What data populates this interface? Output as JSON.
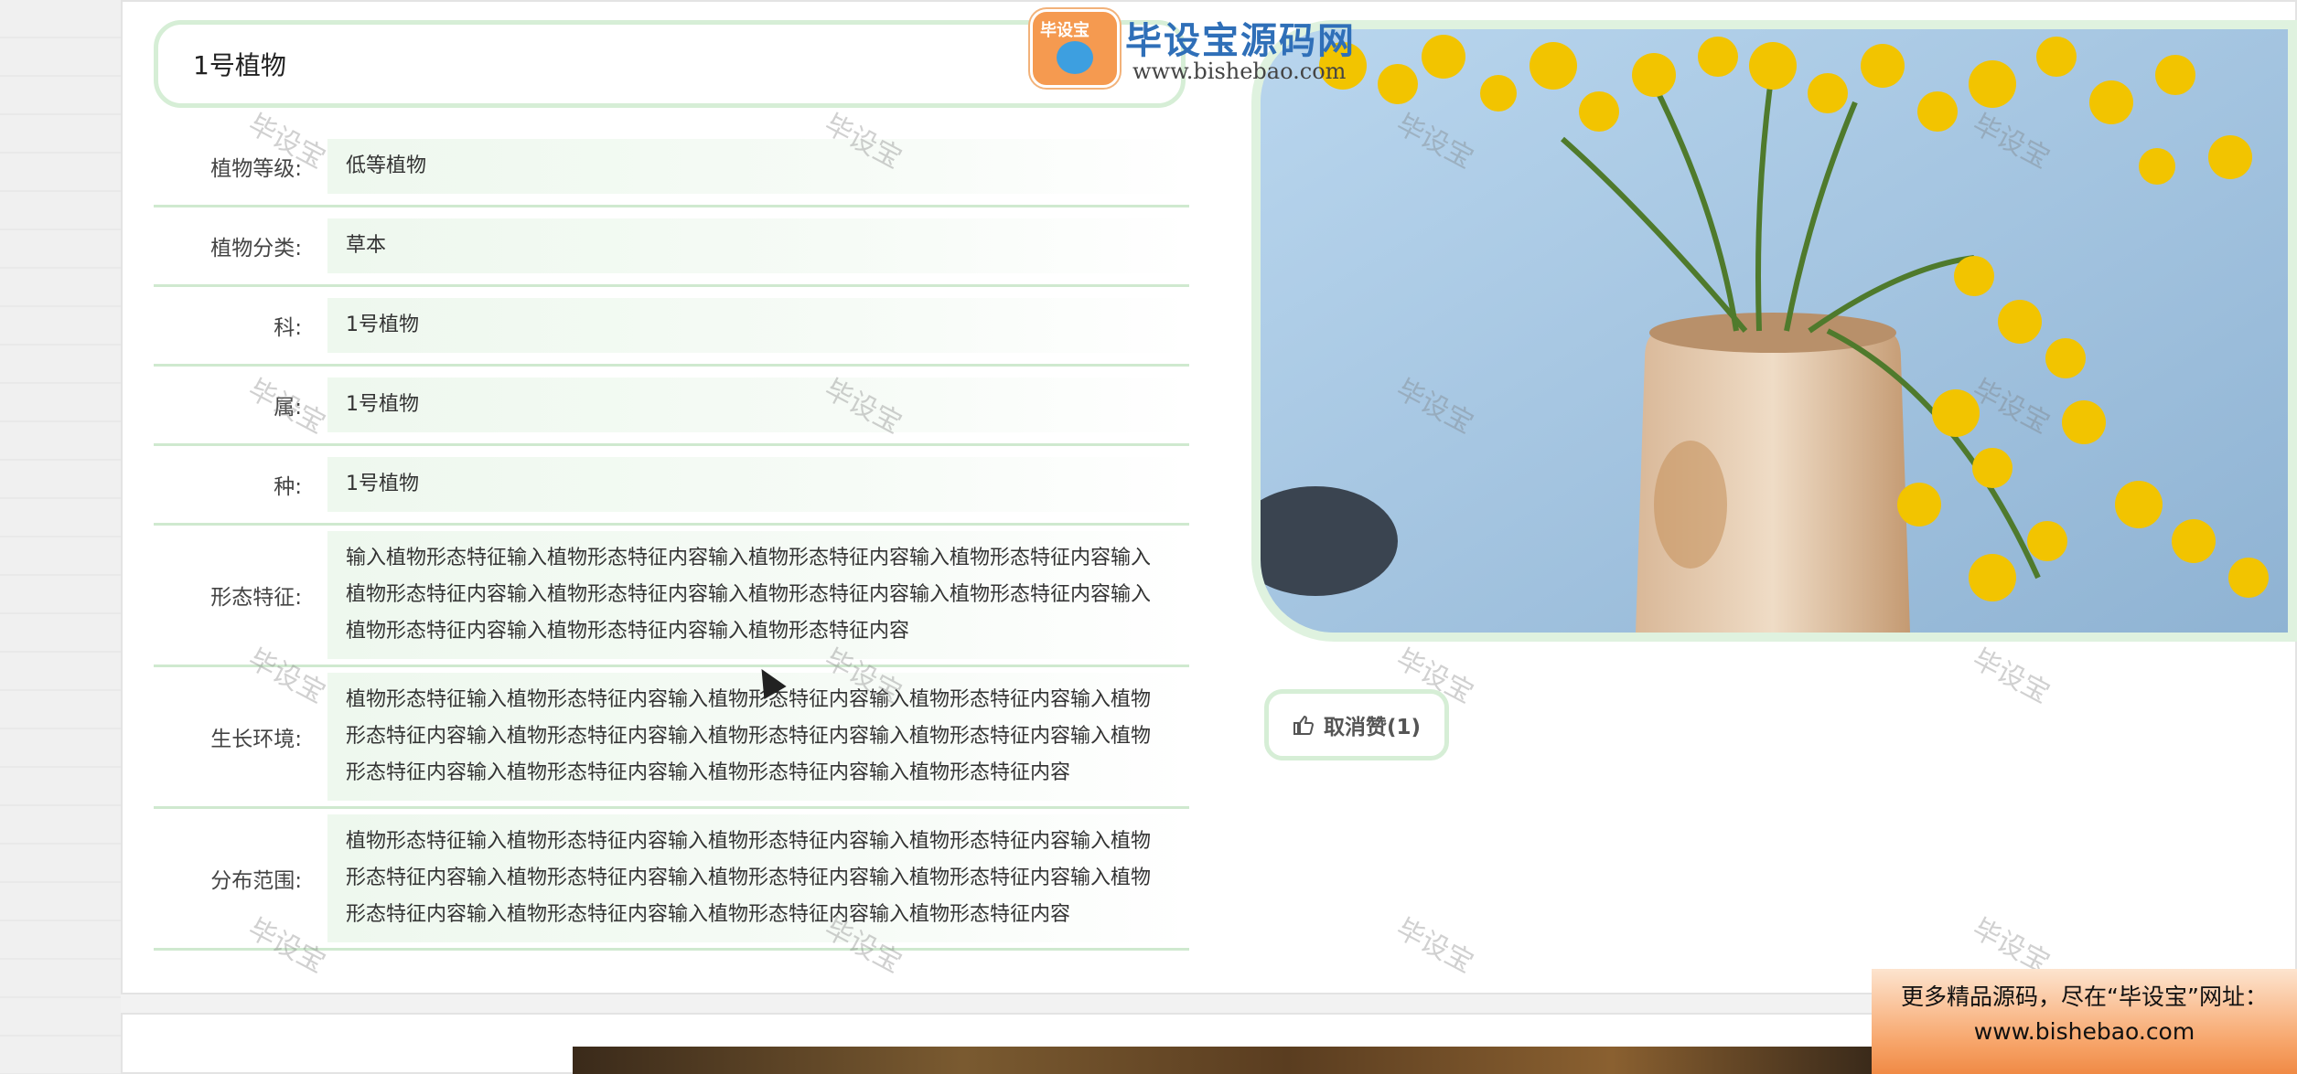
{
  "title": "1号植物",
  "attributes": [
    {
      "label": "植物等级:",
      "value": "低等植物"
    },
    {
      "label": "植物分类:",
      "value": "草本"
    },
    {
      "label": "科:",
      "value": "1号植物"
    },
    {
      "label": "属:",
      "value": "1号植物"
    },
    {
      "label": "种:",
      "value": "1号植物"
    },
    {
      "label": "形态特征:",
      "value": "输入植物形态特征输入植物形态特征内容输入植物形态特征内容输入植物形态特征内容输入植物形态特征内容输入植物形态特征内容输入植物形态特征内容输入植物形态特征内容输入植物形态特征内容输入植物形态特征内容输入植物形态特征内容"
    },
    {
      "label": "生长环境:",
      "value": "植物形态特征输入植物形态特征内容输入植物形态特征内容输入植物形态特征内容输入植物形态特征内容输入植物形态特征内容输入植物形态特征内容输入植物形态特征内容输入植物形态特征内容输入植物形态特征内容输入植物形态特征内容输入植物形态特征内容"
    },
    {
      "label": "分布范围:",
      "value": "植物形态特征输入植物形态特征内容输入植物形态特征内容输入植物形态特征内容输入植物形态特征内容输入植物形态特征内容输入植物形态特征内容输入植物形态特征内容输入植物形态特征内容输入植物形态特征内容输入植物形态特征内容输入植物形态特征内容"
    }
  ],
  "like_button": {
    "label": "取消赞(1)",
    "icon": "thumbs-up-icon"
  },
  "logo": {
    "badge_text": "毕设宝",
    "title": "毕设宝源码网",
    "url": "www.bishebao.com"
  },
  "watermark_text": "毕设宝",
  "promo": {
    "line1": "更多精品源码，尽在“毕设宝”网址：",
    "line2": "www.bishebao.com"
  },
  "colors": {
    "accent_border": "#d6eed6",
    "row_divider": "#cfe9cf",
    "promo": "#f7a56a",
    "logo_blue": "#2f6fb8"
  }
}
